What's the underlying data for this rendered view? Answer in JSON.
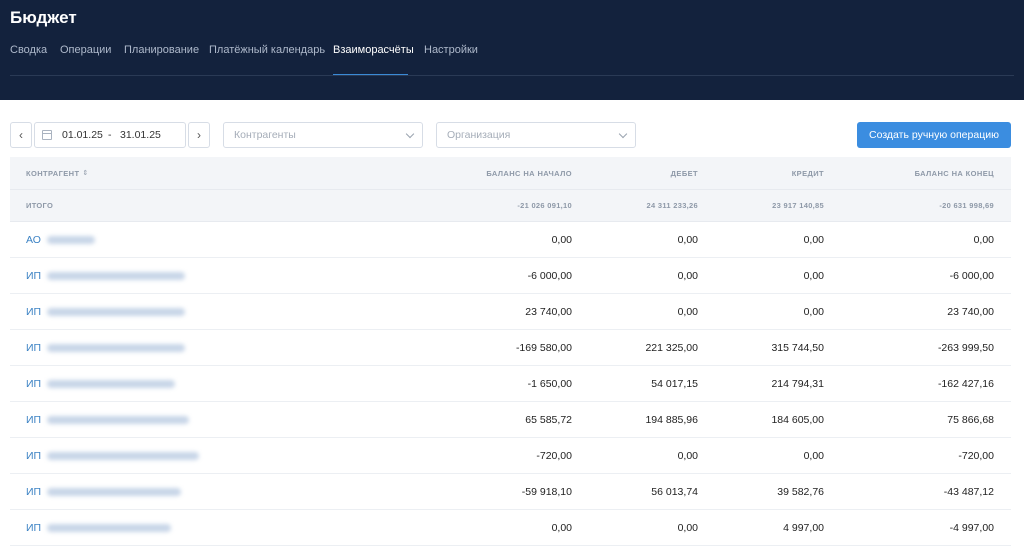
{
  "app": {
    "title": "Бюджет"
  },
  "tabs": [
    {
      "label": "Сводка"
    },
    {
      "label": "Операции"
    },
    {
      "label": "Планирование"
    },
    {
      "label": "Платёжный календарь"
    },
    {
      "label": "Взаиморасчёты",
      "active": true
    },
    {
      "label": "Настройки"
    }
  ],
  "filters": {
    "date_from": "01.01.25",
    "date_sep": "-",
    "date_to": "31.01.25",
    "counterparties_placeholder": "Контрагенты",
    "organization_placeholder": "Организация",
    "create_button": "Создать ручную операцию",
    "prev_icon": "chevron-left-icon",
    "next_icon": "chevron-right-icon",
    "calendar_icon": "calendar-icon"
  },
  "table": {
    "headers": {
      "name": "КОНТРАГЕНТ",
      "start_balance": "БАЛАНС НА НАЧАЛО",
      "debit": "ДЕБЕТ",
      "credit": "КРЕДИТ",
      "end_balance": "БАЛАНС НА КОНЕЦ"
    },
    "sort_icon": "sort-icon",
    "total": {
      "label": "ИТОГО",
      "start_balance": "-21 026 091,10",
      "debit": "24 311 233,26",
      "credit": "23 917 140,85",
      "end_balance": "-20 631 998,69"
    },
    "rows": [
      {
        "type": "АО",
        "start_balance": "0,00",
        "debit": "0,00",
        "credit": "0,00",
        "end_balance": "0,00"
      },
      {
        "type": "ИП",
        "start_balance": "-6 000,00",
        "debit": "0,00",
        "credit": "0,00",
        "end_balance": "-6 000,00"
      },
      {
        "type": "ИП",
        "start_balance": "23 740,00",
        "debit": "0,00",
        "credit": "0,00",
        "end_balance": "23 740,00"
      },
      {
        "type": "ИП",
        "start_balance": "-169 580,00",
        "debit": "221 325,00",
        "credit": "315 744,50",
        "end_balance": "-263 999,50"
      },
      {
        "type": "ИП",
        "start_balance": "-1 650,00",
        "debit": "54 017,15",
        "credit": "214 794,31",
        "end_balance": "-162 427,16"
      },
      {
        "type": "ИП",
        "start_balance": "65 585,72",
        "debit": "194 885,96",
        "credit": "184 605,00",
        "end_balance": "75 866,68"
      },
      {
        "type": "ИП",
        "start_balance": "-720,00",
        "debit": "0,00",
        "credit": "0,00",
        "end_balance": "-720,00"
      },
      {
        "type": "ИП",
        "start_balance": "-59 918,10",
        "debit": "56 013,74",
        "credit": "39 582,76",
        "end_balance": "-43 487,12"
      },
      {
        "type": "ИП",
        "start_balance": "0,00",
        "debit": "0,00",
        "credit": "4 997,00",
        "end_balance": "-4 997,00"
      }
    ]
  },
  "colors": {
    "header_bg": "#13223d",
    "accent": "#3b8de0",
    "link": "#3b82c4"
  }
}
